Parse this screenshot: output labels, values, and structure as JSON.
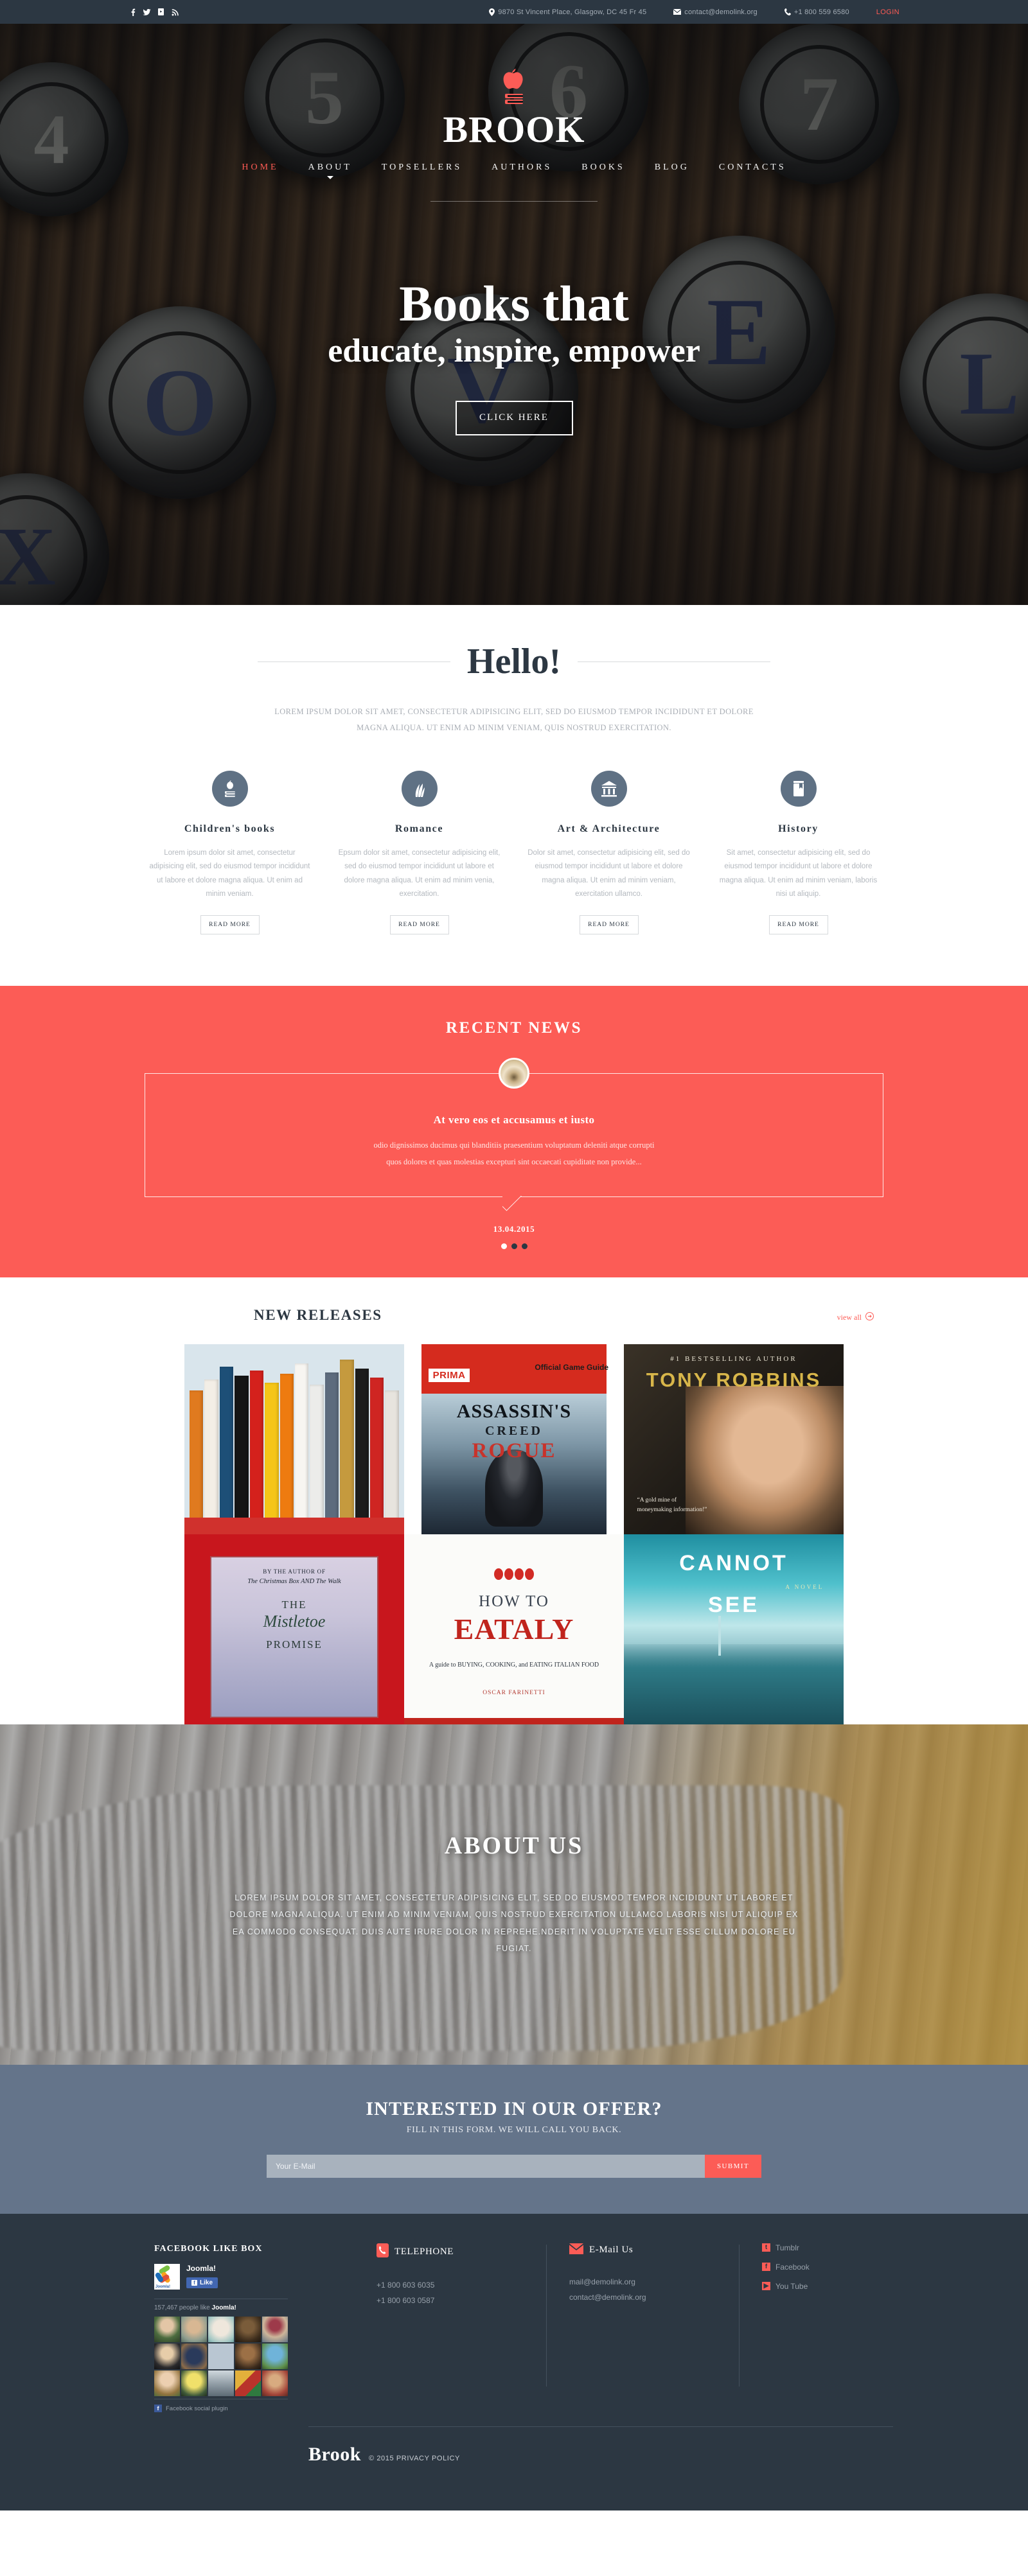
{
  "topbar": {
    "social": [
      {
        "name": "facebook-icon",
        "glyph": "f"
      },
      {
        "name": "twitter-icon",
        "glyph": "ᵗ"
      },
      {
        "name": "youtube-icon",
        "glyph": "▶"
      },
      {
        "name": "rss-icon",
        "glyph": "⟳"
      }
    ],
    "address": "9870 St Vincent Place, Glasgow, DC 45 Fr 45",
    "email": "contact@demolink.org",
    "phone": "+1 800 559 6580",
    "login": "LOGIN"
  },
  "header": {
    "brand": "BROOK",
    "logo_icon": "apple-on-book-icon",
    "nav": [
      {
        "label": "HOME",
        "active": true,
        "dropdown": false
      },
      {
        "label": "ABOUT",
        "active": false,
        "dropdown": true
      },
      {
        "label": "TOPSELLERS",
        "active": false,
        "dropdown": false
      },
      {
        "label": "AUTHORS",
        "active": false,
        "dropdown": false
      },
      {
        "label": "BOOKS",
        "active": false,
        "dropdown": false
      },
      {
        "label": "BLOG",
        "active": false,
        "dropdown": false
      },
      {
        "label": "CONTACTS",
        "active": false,
        "dropdown": false
      }
    ]
  },
  "hero": {
    "title": "Books that",
    "subtitle": "educate, inspire, empower",
    "button": "CLICK HERE"
  },
  "hello": {
    "title": "Hello!",
    "intro": "LOREM IPSUM DOLOR SIT AMET, CONSECTETUR ADIPISICING ELIT, SED DO EIUSMOD TEMPOR INCIDIDUNT ET DOLORE MAGNA ALIQUA. UT ENIM AD MINIM VENIAM, QUIS NOSTRUD EXERCITATION.",
    "columns": [
      {
        "icon": "apple-book-icon",
        "title": "Children's books",
        "text": "Lorem ipsum dolor sit amet, consectetur adipisicing elit, sed do eiusmod tempor incididunt ut labore et dolore magna aliqua. Ut enim ad minim veniam.",
        "button": "READ MORE"
      },
      {
        "icon": "leaf-icon",
        "title": "Romance",
        "text": "Epsum dolor sit amet, consectetur adipisicing elit, sed do eiusmod tempor incididunt ut labore et dolore magna aliqua. Ut enim ad minim venia, exercitation.",
        "button": "READ MORE"
      },
      {
        "icon": "museum-building-icon",
        "title": "Art & Architecture",
        "text": "Dolor sit amet, consectetur adipisicing elit, sed do eiusmod tempor incididunt ut labore et dolore magna aliqua. Ut enim ad minim veniam, exercitation ullamco.",
        "button": "READ MORE"
      },
      {
        "icon": "book-bookmark-icon",
        "title": "History",
        "text": "Sit amet, consectetur adipisicing elit, sed do eiusmod tempor incididunt ut labore et dolore magna aliqua. Ut enim ad minim veniam, laboris nisi ut aliquip.",
        "button": "READ MORE"
      }
    ]
  },
  "news": {
    "section_title": "RECENT NEWS",
    "avatar_icon": "open-book-avatar",
    "headline": "At vero eos et accusamus et iusto",
    "line1": "odio dignissimos ducimus qui blanditiis praesentium voluptatum deleniti atque corrupti",
    "line2": "quos dolores et quas molestias excepturi sint occaecati cupiditate non provide...",
    "date": "13.04.2015",
    "slides": 3,
    "active_slide": 1
  },
  "releases": {
    "title": "NEW RELEASES",
    "view_all": "view all",
    "view_all_icon": "arrow-right-circle-icon",
    "books": [
      {
        "name": "bookshelf-spines",
        "title": "Bookshelf collection"
      },
      {
        "name": "assassins-creed-rogue",
        "prima": "PRIMA",
        "guide": "Official Game Guide",
        "t1": "ASSASSIN'S",
        "t2": "CREED",
        "t3": "ROGUE"
      },
      {
        "name": "tony-robbins",
        "bestseller": "#1 BESTSELLING AUTHOR",
        "author": "TONY ROBBINS",
        "quote": "“A gold mine of moneymaking information!”"
      },
      {
        "name": "the-mistletoe-promise",
        "byline": "BY THE AUTHOR OF",
        "books_by": "The Christmas Box AND The Walk",
        "t1": "THE",
        "t2": "Mistletoe",
        "t3": "PROMISE"
      },
      {
        "name": "how-to-eataly",
        "t1": "HOW TO",
        "t2": "EATALY",
        "sub": "A guide to BUYING, COOKING, and EATING ITALIAN FOOD",
        "author": "OSCAR FARINETTI"
      },
      {
        "name": "cannot-see",
        "t1": "CANNOT",
        "t2": "SEE",
        "novel": "A NOVEL"
      }
    ]
  },
  "about": {
    "title": "ABOUT US",
    "text": "LOREM IPSUM DOLOR SIT AMET, CONSECTETUR ADIPISICING ELIT, SED DO EIUSMOD TEMPOR INCIDIDUNT UT LABORE ET DOLORE MAGNA ALIQUA. UT ENIM AD MINIM VENIAM, QUIS NOSTRUD EXERCITATION ULLAMCO LABORIS NISI UT ALIQUIP EX EA COMMODO CONSEQUAT. DUIS AUTE IRURE DOLOR IN REPREHE.NDERIT IN VOLUPTATE VELIT ESSE CILLUM DOLORE EU FUGIAT."
  },
  "offer": {
    "title": "INTERESTED IN OUR OFFER?",
    "subtitle": "FILL IN THIS FORM. WE WILL CALL YOU BACK.",
    "placeholder": "Your E-Mail",
    "value": "",
    "submit": "SUBMIT"
  },
  "footer": {
    "facebook_box": {
      "heading": "FACEBOOK LIKE BOX",
      "page_name": "Joomla!",
      "like_label": "Like",
      "count_text": "157,467 people like",
      "count_brand": "Joomla!",
      "plugin_label": "Facebook social plugin"
    },
    "telephone": {
      "icon": "phone-icon",
      "heading": "TELEPHONE",
      "lines": [
        "+1 800 603 6035",
        "+1 800 603 0587"
      ]
    },
    "email": {
      "icon": "envelope-icon",
      "heading": "E-Mail Us",
      "lines": [
        "mail@demolink.org",
        "contact@demolink.org"
      ]
    },
    "social": [
      {
        "icon": "tumblr-icon",
        "glyph": "t",
        "label": "Tumblr"
      },
      {
        "icon": "facebook-icon",
        "glyph": "f",
        "label": "Facebook"
      },
      {
        "icon": "youtube-icon",
        "glyph": "▶",
        "label": "You Tube"
      }
    ],
    "brand": "Brook",
    "copyright": "© 2015 PRIVACY POLICY"
  },
  "colors": {
    "accent": "#fc5c56",
    "dark": "#2c3742",
    "slate": "#64748a",
    "icon_circle": "#5f7184"
  }
}
